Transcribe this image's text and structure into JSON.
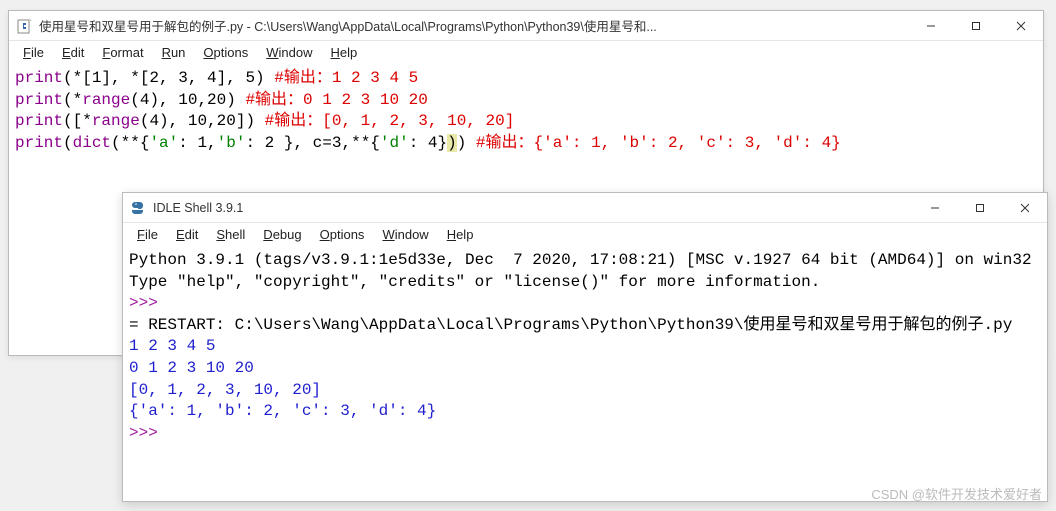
{
  "editor": {
    "title": "使用星号和双星号用于解包的例子.py - C:\\Users\\Wang\\AppData\\Local\\Programs\\Python\\Python39\\使用星号和...",
    "menu": [
      "File",
      "Edit",
      "Format",
      "Run",
      "Options",
      "Window",
      "Help"
    ],
    "lines": [
      {
        "tokens": [
          {
            "t": "print",
            "c": "kw"
          },
          {
            "t": "(*[1], *[2, 3, 4], 5) ",
            "c": "op"
          },
          {
            "t": "#输出：1 2 3 4 5",
            "c": "comment"
          }
        ]
      },
      {
        "tokens": [
          {
            "t": "print",
            "c": "kw"
          },
          {
            "t": "(*",
            "c": "op"
          },
          {
            "t": "range",
            "c": "kw"
          },
          {
            "t": "(4), 10,20) ",
            "c": "op"
          },
          {
            "t": "#输出：0 1 2 3 10 20",
            "c": "comment"
          }
        ]
      },
      {
        "tokens": [
          {
            "t": "print",
            "c": "kw"
          },
          {
            "t": "([*",
            "c": "op"
          },
          {
            "t": "range",
            "c": "kw"
          },
          {
            "t": "(4), 10,20]) ",
            "c": "op"
          },
          {
            "t": "#输出：[0, 1, 2, 3, 10, 20]",
            "c": "comment"
          }
        ]
      },
      {
        "tokens": [
          {
            "t": "print",
            "c": "kw"
          },
          {
            "t": "(",
            "c": "op"
          },
          {
            "t": "dict",
            "c": "kw"
          },
          {
            "t": "(**{",
            "c": "op"
          },
          {
            "t": "'a'",
            "c": "str"
          },
          {
            "t": ": 1,",
            "c": "op"
          },
          {
            "t": "'b'",
            "c": "str"
          },
          {
            "t": ": 2 }, c=3,**{",
            "c": "op"
          },
          {
            "t": "'d'",
            "c": "str"
          },
          {
            "t": ": 4}",
            "c": "op"
          },
          {
            "t": ")",
            "c": "op yellow-hl"
          },
          {
            "t": ") ",
            "c": "op"
          },
          {
            "t": "#输出：{'a': 1, 'b': 2, 'c': 3, 'd': 4}",
            "c": "comment"
          }
        ]
      }
    ]
  },
  "shell": {
    "title": "IDLE Shell 3.9.1",
    "menu": [
      "File",
      "Edit",
      "Shell",
      "Debug",
      "Options",
      "Window",
      "Help"
    ],
    "banner1": "Python 3.9.1 (tags/v3.9.1:1e5d33e, Dec  7 2020, 17:08:21) [MSC v.1927 64 bit (AMD64)] on win32",
    "banner2": "Type \"help\", \"copyright\", \"credits\" or \"license()\" for more information.",
    "prompt": ">>>",
    "restart": "= RESTART: C:\\Users\\Wang\\AppData\\Local\\Programs\\Python\\Python39\\使用星号和双星号用于解包的例子.py",
    "outputs": [
      "1 2 3 4 5",
      "0 1 2 3 10 20",
      "[0, 1, 2, 3, 10, 20]",
      "{'a': 1, 'b': 2, 'c': 3, 'd': 4}"
    ]
  },
  "watermark": "CSDN @软件开发技术爱好者"
}
